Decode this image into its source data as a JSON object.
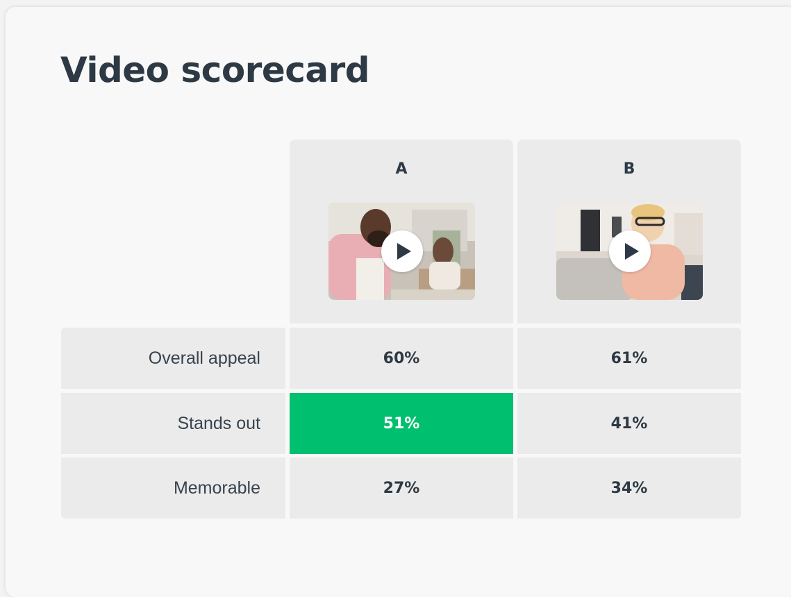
{
  "title": "Video scorecard",
  "columns": [
    {
      "label": "A",
      "thumbnail": "video-thumbnail-man-laptop"
    },
    {
      "label": "B",
      "thumbnail": "video-thumbnail-woman-glasses"
    }
  ],
  "rows": [
    {
      "label": "Overall appeal",
      "a": "60%",
      "b": "61%"
    },
    {
      "label": "Stands out",
      "a": "51%",
      "b": "41%"
    },
    {
      "label": "Memorable",
      "a": "27%",
      "b": "34%"
    }
  ],
  "colors": {
    "highlight": "#00bf6f",
    "cell": "#ebebeb",
    "text": "#2d3944"
  }
}
